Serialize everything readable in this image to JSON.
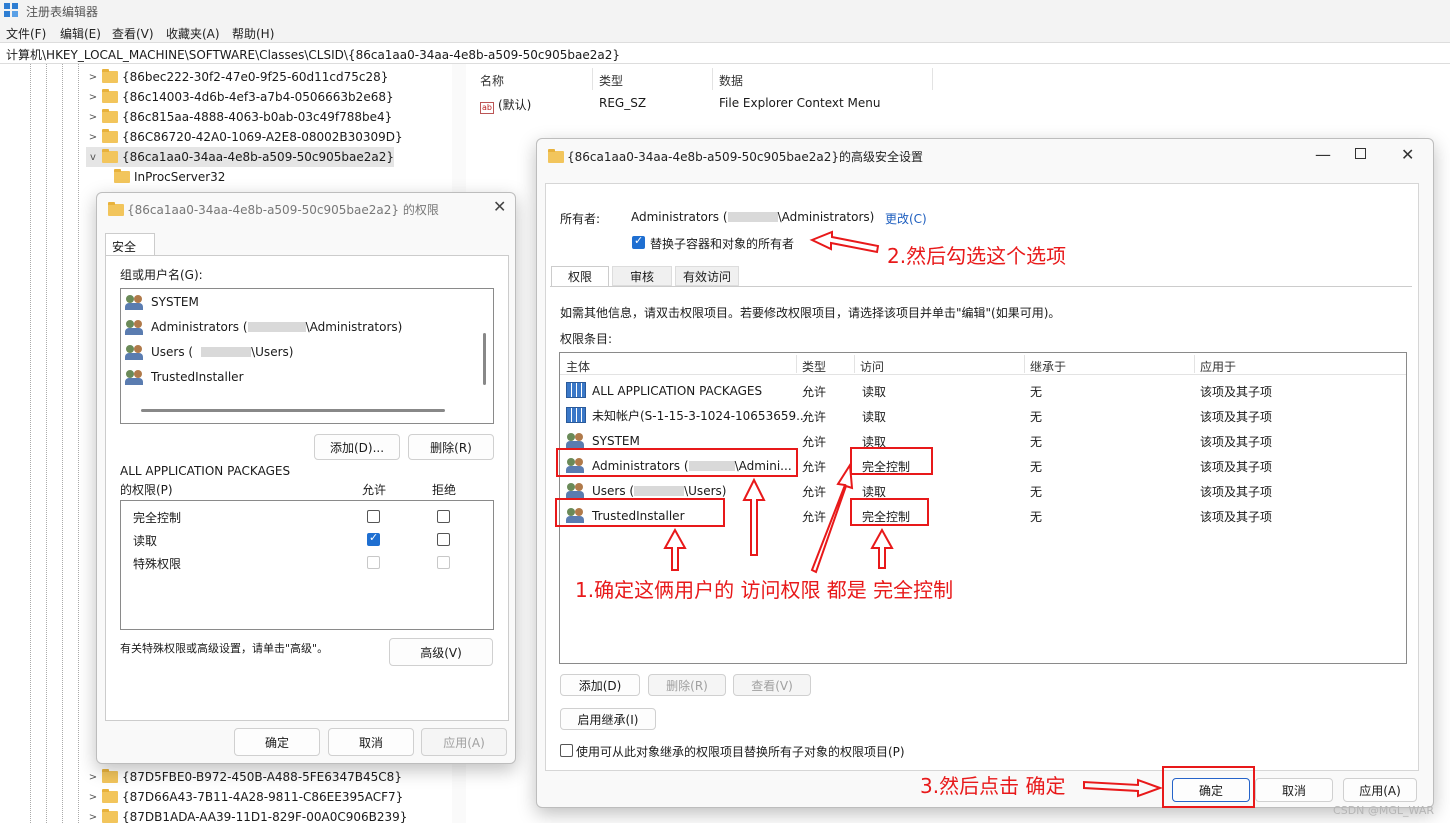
{
  "app": {
    "title": "注册表编辑器"
  },
  "menu": [
    "文件(F)",
    "编辑(E)",
    "查看(V)",
    "收藏夹(A)",
    "帮助(H)"
  ],
  "address": "计算机\\HKEY_LOCAL_MACHINE\\SOFTWARE\\Classes\\CLSID\\{86ca1aa0-34aa-4e8b-a509-50c905bae2a2}",
  "tree": {
    "items_top": [
      "{86bec222-30f2-47e0-9f25-60d11cd75c28}",
      "{86c14003-4d6b-4ef3-a7b4-0506663b2e68}",
      "{86c815aa-4888-4063-b0ab-03c49f788be4}",
      "{86C86720-42A0-1069-A2E8-08002B30309D}",
      "{86ca1aa0-34aa-4e8b-a509-50c905bae2a2}"
    ],
    "child": "InProcServer32",
    "items_bottom": [
      "{87D5FBE0-B972-450B-A488-5FE6347B45C8}",
      "{87D66A43-7B11-4A28-9811-C86EE395ACF7}",
      "{87DB1ADA-AA39-11D1-829F-00A0C906B239}"
    ]
  },
  "values_pane": {
    "headers": [
      "名称",
      "类型",
      "数据"
    ],
    "row": {
      "name": "(默认)",
      "type": "REG_SZ",
      "data": "File Explorer Context Menu"
    }
  },
  "perm_dialog": {
    "title": "{86ca1aa0-34aa-4e8b-a509-50c905bae2a2} 的权限",
    "tab": "安全",
    "group_label": "组或用户名(G):",
    "users": [
      {
        "name": "SYSTEM"
      },
      {
        "name": "Administrators (",
        "suffix": "\\Administrators)"
      },
      {
        "name": "Users (",
        "suffix": "\\Users)"
      },
      {
        "name": "TrustedInstaller"
      }
    ],
    "add_button": "添加(D)...",
    "remove_button": "删除(R)",
    "perm_for_line1": "ALL APPLICATION PACKAGES",
    "perm_for_line2": "的权限(P)",
    "allow_label": "允许",
    "deny_label": "拒绝",
    "permissions": [
      {
        "name": "完全控制",
        "allow": false,
        "deny": false
      },
      {
        "name": "读取",
        "allow": true,
        "deny": false
      },
      {
        "name": "特殊权限",
        "allow": false,
        "deny": false
      }
    ],
    "advanced_hint": "有关特殊权限或高级设置，请单击\"高级\"。",
    "advanced_button": "高级(V)",
    "ok": "确定",
    "cancel": "取消",
    "apply": "应用(A)"
  },
  "adv_dialog": {
    "title": "{86ca1aa0-34aa-4e8b-a509-50c905bae2a2}的高级安全设置",
    "owner_label": "所有者:",
    "owner_value_pre": "Administrators (",
    "owner_value_post": "\\Administrators)",
    "change_link": "更改(C)",
    "replace_owner": "替换子容器和对象的所有者",
    "tabs": [
      "权限",
      "审核",
      "有效访问"
    ],
    "info": "如需其他信息，请双击权限项目。若要修改权限项目，请选择该项目并单击\"编辑\"(如果可用)。",
    "entries_label": "权限条目:",
    "columns": [
      "主体",
      "类型",
      "访问",
      "继承于",
      "应用于"
    ],
    "entries": [
      {
        "principal": "ALL APPLICATION PACKAGES",
        "type": "允许",
        "access": "读取",
        "inherit": "无",
        "apply": "该项及其子项",
        "icon": "package-icon"
      },
      {
        "principal": "未知帐户(S-1-15-3-1024-10653659...",
        "type": "允许",
        "access": "读取",
        "inherit": "无",
        "apply": "该项及其子项",
        "icon": "package-icon"
      },
      {
        "principal": "SYSTEM",
        "type": "允许",
        "access": "读取",
        "inherit": "无",
        "apply": "该项及其子项",
        "icon": "users-icon"
      },
      {
        "principal": "Administrators (",
        "principal_tail": "\\Admini...",
        "type": "允许",
        "access": "完全控制",
        "inherit": "无",
        "apply": "该项及其子项",
        "icon": "users-icon"
      },
      {
        "principal": "Users (",
        "principal_tail": "\\Users)",
        "type": "允许",
        "access": "读取",
        "inherit": "无",
        "apply": "该项及其子项",
        "icon": "users-icon"
      },
      {
        "principal": "TrustedInstaller",
        "type": "允许",
        "access": "完全控制",
        "inherit": "无",
        "apply": "该项及其子项",
        "icon": "users-icon"
      }
    ],
    "add": "添加(D)",
    "remove": "删除(R)",
    "view": "查看(V)",
    "enable_inherit": "启用继承(I)",
    "replace_child": "使用可从此对象继承的权限项目替换所有子对象的权限项目(P)",
    "ok": "确定",
    "cancel": "取消",
    "apply": "应用(A)"
  },
  "annotations": {
    "step1": "1.确定这俩用户的 访问权限 都是 完全控制",
    "step2": "2.然后勾选这个选项",
    "step3": "3.然后点击 确定"
  },
  "watermark": "CSDN @MGL_WAR",
  "colors": {
    "annotation": "#e8191a",
    "accent": "#1f6fd1",
    "link": "#1f5fbf"
  }
}
